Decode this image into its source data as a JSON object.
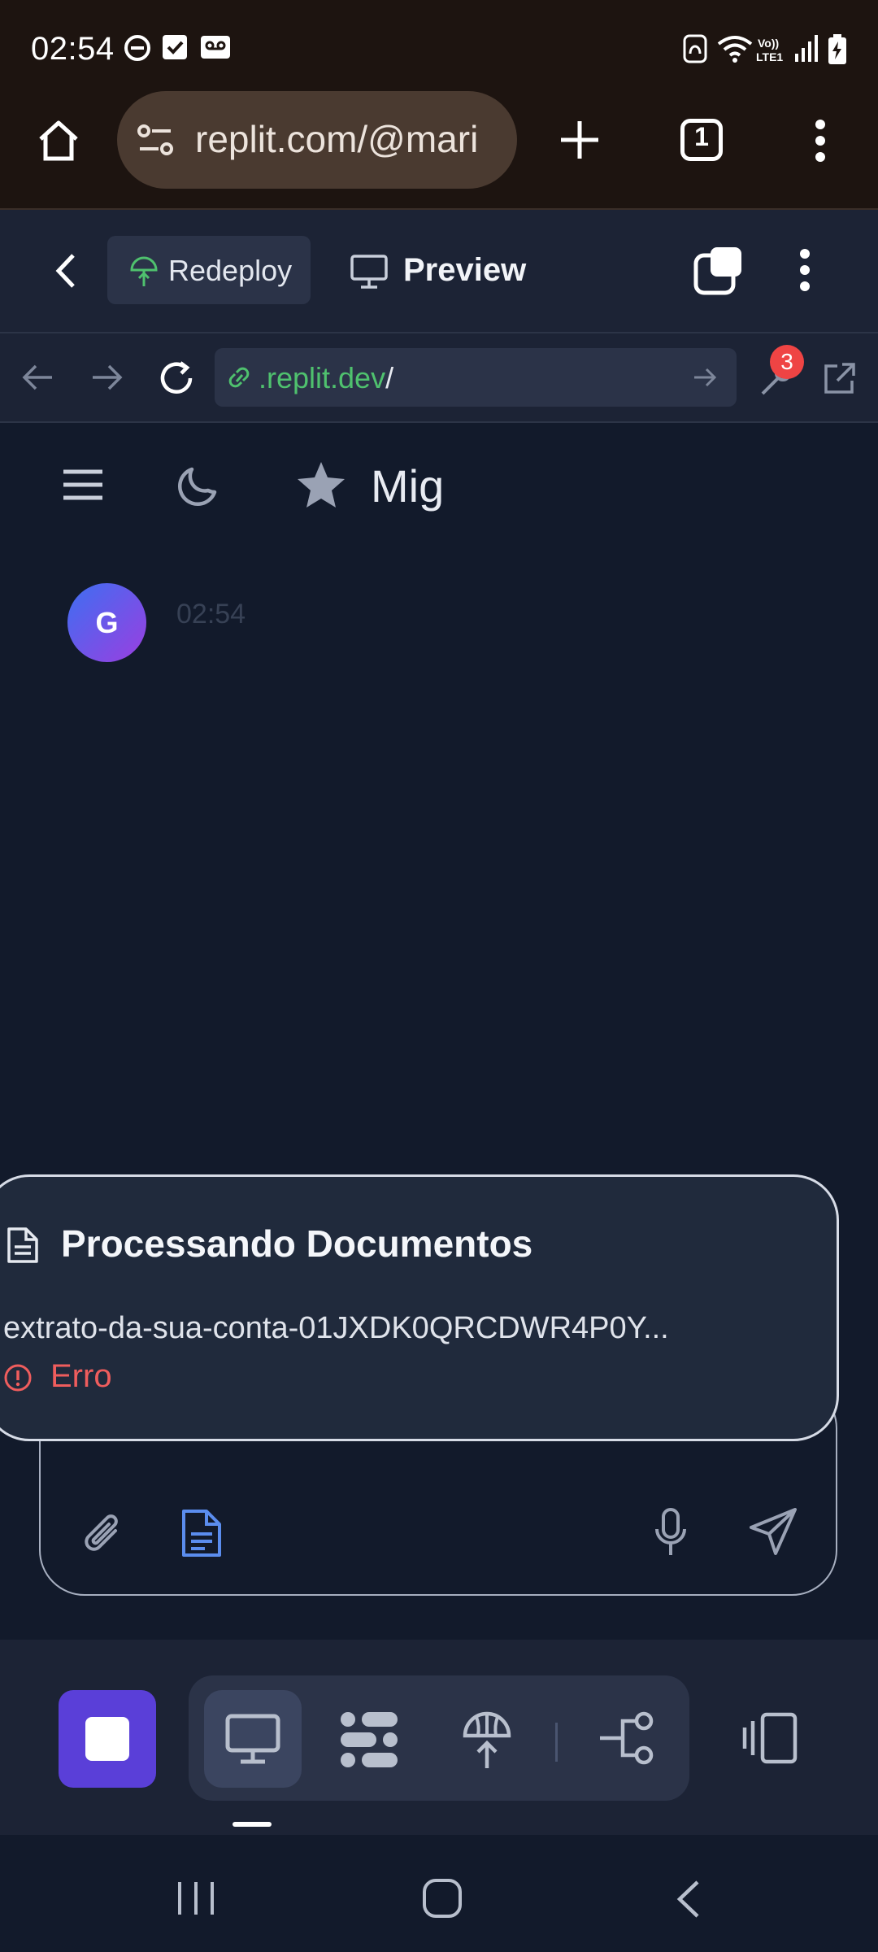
{
  "status_bar": {
    "time": "02:54",
    "icons": [
      "do-not-disturb-icon",
      "checkbox-icon",
      "voicemail-icon",
      "nfc-icon",
      "wifi-icon",
      "volte-icon",
      "signal-icon",
      "battery-charging-icon"
    ]
  },
  "browser": {
    "url": "replit.com/@mari",
    "tab_count": "1"
  },
  "replit_header": {
    "redeploy_label": "Redeploy",
    "preview_label": "Preview"
  },
  "webview": {
    "url_domain": ".replit.dev",
    "url_path": "/",
    "devtools_badge": "3"
  },
  "app": {
    "title": "Mig",
    "avatar_letter": "G",
    "message_time": "02:54"
  },
  "processing": {
    "title": "Processando Documentos",
    "file_name": "extrato-da-sua-conta-01JXDK0QRCDWR4P0Y...",
    "status": "Erro"
  },
  "colors": {
    "stop_button": "#5a3fd8",
    "error": "#ef5d5d",
    "url_green": "#4fc16e",
    "doc_icon_blue": "#5b8dee"
  }
}
